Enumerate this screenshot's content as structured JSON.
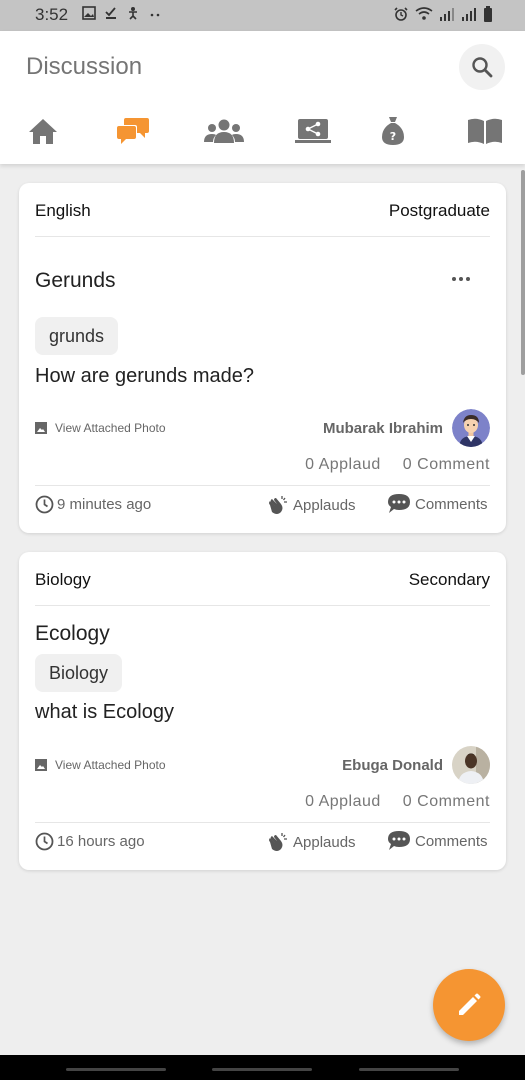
{
  "status_bar": {
    "time": "3:52",
    "left_icons": [
      "image-icon",
      "download-done-icon",
      "accessibility-icon",
      "more-dots-icon"
    ],
    "right_icons": [
      "alarm-icon",
      "wifi-icon",
      "signal-icon",
      "signal-icon",
      "battery-icon"
    ]
  },
  "header": {
    "title": "Discussion",
    "search_icon": "search-icon",
    "nav_tabs": [
      {
        "icon": "home-icon",
        "active": false
      },
      {
        "icon": "discussion-icon",
        "active": true
      },
      {
        "icon": "group-icon",
        "active": false
      },
      {
        "icon": "screen-share-icon",
        "active": false
      },
      {
        "icon": "money-bag-icon",
        "active": false
      },
      {
        "icon": "book-icon",
        "active": false
      }
    ]
  },
  "colors": {
    "accent": "#f59532",
    "icon_gray": "#757575",
    "background": "#eeeeee"
  },
  "posts": [
    {
      "subject": "English",
      "level": "Postgraduate",
      "title": "Gerunds",
      "tag": "grunds",
      "question": "How are gerunds made?",
      "attachment_label": "View Attached Photo",
      "author": "Mubarak Ibrahim",
      "applaud_count_text": "0  Applaud",
      "comment_count_text": "0  Comment",
      "time_ago": "9 minutes ago",
      "applauds_label": "Applauds",
      "comments_label": "Comments"
    },
    {
      "subject": "Biology",
      "level": "Secondary",
      "title": "Ecology",
      "tag": "Biology",
      "question": "what is Ecology",
      "attachment_label": "View Attached Photo",
      "author": "Ebuga Donald",
      "applaud_count_text": "0  Applaud",
      "comment_count_text": "0  Comment",
      "time_ago": "16 hours ago",
      "applauds_label": "Applauds",
      "comments_label": "Comments"
    }
  ],
  "fab": {
    "icon": "pencil-icon"
  }
}
